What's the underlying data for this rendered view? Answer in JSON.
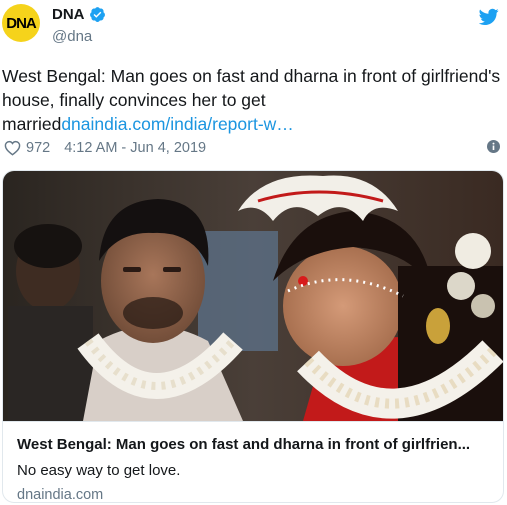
{
  "account": {
    "logo_text": "DNA",
    "display_name": "DNA",
    "handle": "@dna",
    "verified": true
  },
  "tweet": {
    "text_plain": "West Bengal: Man goes on fast and dharna in front of girlfriend's house, finally convinces her to get married",
    "text_link": "dnaindia.com/india/report-w…"
  },
  "meta": {
    "likes": "972",
    "timestamp": "4:12 AM - Jun 4, 2019"
  },
  "card": {
    "title": "West Bengal: Man goes on fast and dharna in front of girlfrien...",
    "description": "No easy way to get love.",
    "domain": "dnaindia.com"
  },
  "icons": {
    "verified": "verified-badge-icon",
    "platform": "twitter-bird-icon",
    "like": "heart-icon",
    "info": "info-icon"
  },
  "colors": {
    "link": "#1b95e0",
    "secondary_text": "#657786",
    "brand_blue": "#1da1f2",
    "logo_yellow": "#f5d31b"
  }
}
